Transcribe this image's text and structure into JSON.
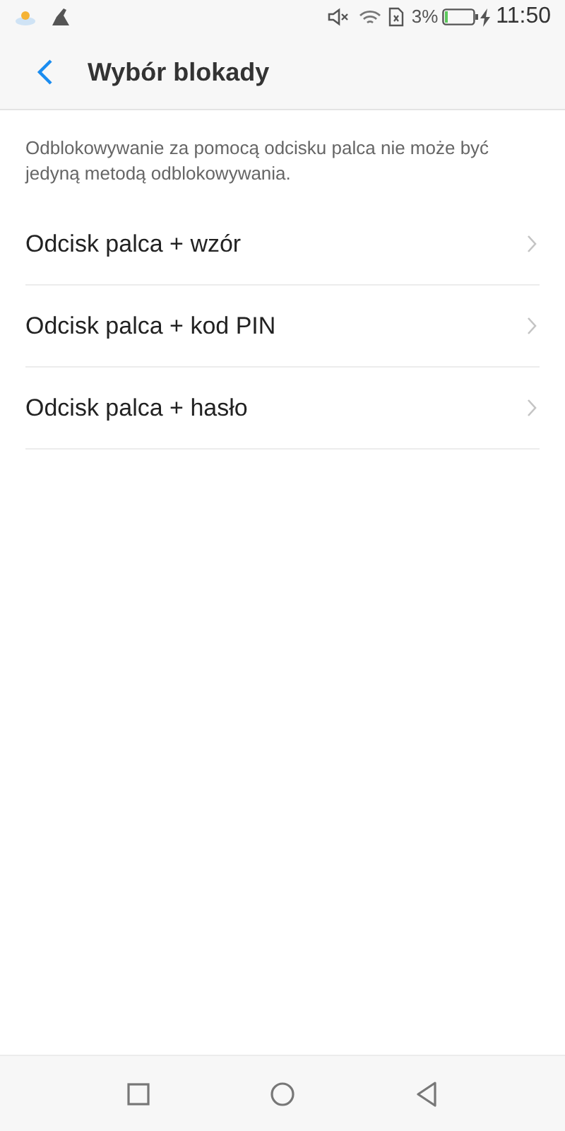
{
  "status_bar": {
    "battery_text": "3%",
    "time": "11:50"
  },
  "header": {
    "title": "Wybór blokady"
  },
  "description": "Odblokowywanie za pomocą odcisku palca nie może być jedyną metodą odblokowywania.",
  "options": [
    {
      "label": "Odcisk palca + wzór"
    },
    {
      "label": "Odcisk palca + kod PIN"
    },
    {
      "label": "Odcisk palca + hasło"
    }
  ]
}
